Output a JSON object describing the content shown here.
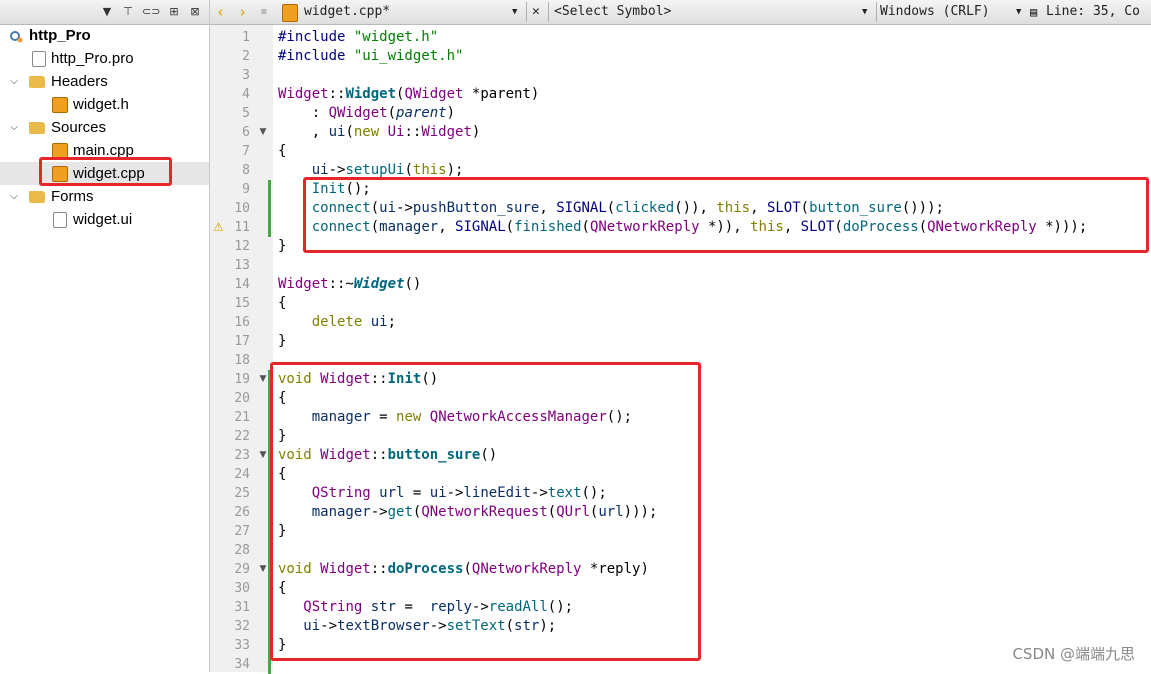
{
  "sidebar": {
    "toolbar_icons": [
      "filter-icon",
      "link-icon",
      "split-icon",
      "close-icon"
    ],
    "tree": [
      {
        "label": "http_Pro",
        "kind": "project",
        "bold": true
      },
      {
        "label": "http_Pro.pro",
        "kind": "pro-file"
      },
      {
        "label": "Headers",
        "kind": "folder"
      },
      {
        "label": "widget.h",
        "kind": "header-file"
      },
      {
        "label": "Sources",
        "kind": "folder"
      },
      {
        "label": "main.cpp",
        "kind": "source-file"
      },
      {
        "label": "widget.cpp",
        "kind": "source-file",
        "selected": true
      },
      {
        "label": "Forms",
        "kind": "folder"
      },
      {
        "label": "widget.ui",
        "kind": "form-file"
      }
    ]
  },
  "editor_toolbar": {
    "file_name": "widget.cpp*",
    "symbol": "<Select Symbol>",
    "line_ending": "Windows (CRLF)",
    "position": "Line: 35, Co"
  },
  "code_lines": [
    [
      [
        "pp",
        "#include "
      ],
      [
        "str",
        "\"widget.h\""
      ]
    ],
    [
      [
        "pp",
        "#include "
      ],
      [
        "str",
        "\"ui_widget.h\""
      ]
    ],
    [],
    [
      [
        "type",
        "Widget"
      ],
      [
        "plain",
        "::"
      ],
      [
        "fnb",
        "Widget"
      ],
      [
        "plain",
        "("
      ],
      [
        "type",
        "QWidget"
      ],
      [
        "plain",
        " *parent)"
      ]
    ],
    [
      [
        "plain",
        "    : "
      ],
      [
        "type",
        "QWidget"
      ],
      [
        "plain",
        "("
      ],
      [
        "param",
        "parent"
      ],
      [
        "plain",
        ")"
      ]
    ],
    [
      [
        "plain",
        "    , "
      ],
      [
        "var",
        "ui"
      ],
      [
        "plain",
        "("
      ],
      [
        "kw",
        "new"
      ],
      [
        "plain",
        " "
      ],
      [
        "type",
        "Ui"
      ],
      [
        "plain",
        "::"
      ],
      [
        "type",
        "Widget"
      ],
      [
        "plain",
        ")"
      ]
    ],
    [
      [
        "plain",
        "{"
      ]
    ],
    [
      [
        "plain",
        "    "
      ],
      [
        "var",
        "ui"
      ],
      [
        "plain",
        "->"
      ],
      [
        "fn",
        "setupUi"
      ],
      [
        "plain",
        "("
      ],
      [
        "kw",
        "this"
      ],
      [
        "plain",
        ");"
      ]
    ],
    [
      [
        "plain",
        "    "
      ],
      [
        "fn",
        "Init"
      ],
      [
        "plain",
        "();"
      ]
    ],
    [
      [
        "plain",
        "    "
      ],
      [
        "fn",
        "connect"
      ],
      [
        "plain",
        "("
      ],
      [
        "var",
        "ui"
      ],
      [
        "plain",
        "->"
      ],
      [
        "var",
        "pushButton_sure"
      ],
      [
        "plain",
        ", "
      ],
      [
        "pp",
        "SIGNAL"
      ],
      [
        "plain",
        "("
      ],
      [
        "fn",
        "clicked"
      ],
      [
        "plain",
        "()), "
      ],
      [
        "kw",
        "this"
      ],
      [
        "plain",
        ", "
      ],
      [
        "pp",
        "SLOT"
      ],
      [
        "plain",
        "("
      ],
      [
        "fn",
        "button_sure"
      ],
      [
        "plain",
        "()));"
      ]
    ],
    [
      [
        "plain",
        "    "
      ],
      [
        "fn",
        "connect"
      ],
      [
        "plain",
        "("
      ],
      [
        "var",
        "manager"
      ],
      [
        "plain",
        ", "
      ],
      [
        "pp",
        "SIGNAL"
      ],
      [
        "plain",
        "("
      ],
      [
        "fn",
        "finished"
      ],
      [
        "plain",
        "("
      ],
      [
        "type",
        "QNetworkReply"
      ],
      [
        "plain",
        " *)), "
      ],
      [
        "kw",
        "this"
      ],
      [
        "plain",
        ", "
      ],
      [
        "pp",
        "SLOT"
      ],
      [
        "plain",
        "("
      ],
      [
        "fn",
        "doProcess"
      ],
      [
        "plain",
        "("
      ],
      [
        "type",
        "QNetworkReply"
      ],
      [
        "plain",
        " *)));"
      ]
    ],
    [
      [
        "plain",
        "}"
      ]
    ],
    [],
    [
      [
        "type",
        "Widget"
      ],
      [
        "plain",
        "::~"
      ],
      [
        "fni",
        "Widget"
      ],
      [
        "plain",
        "()"
      ]
    ],
    [
      [
        "plain",
        "{"
      ]
    ],
    [
      [
        "plain",
        "    "
      ],
      [
        "kw",
        "delete"
      ],
      [
        "plain",
        " "
      ],
      [
        "var",
        "ui"
      ],
      [
        "plain",
        ";"
      ]
    ],
    [
      [
        "plain",
        "}"
      ]
    ],
    [],
    [
      [
        "kw",
        "void"
      ],
      [
        "plain",
        " "
      ],
      [
        "type",
        "Widget"
      ],
      [
        "plain",
        "::"
      ],
      [
        "fnb",
        "Init"
      ],
      [
        "plain",
        "()"
      ]
    ],
    [
      [
        "plain",
        "{"
      ]
    ],
    [
      [
        "plain",
        "    "
      ],
      [
        "var",
        "manager"
      ],
      [
        "plain",
        " = "
      ],
      [
        "kw",
        "new"
      ],
      [
        "plain",
        " "
      ],
      [
        "type",
        "QNetworkAccessManager"
      ],
      [
        "plain",
        "();"
      ]
    ],
    [
      [
        "plain",
        "}"
      ]
    ],
    [
      [
        "kw",
        "void"
      ],
      [
        "plain",
        " "
      ],
      [
        "type",
        "Widget"
      ],
      [
        "plain",
        "::"
      ],
      [
        "fnb",
        "button_sure"
      ],
      [
        "plain",
        "()"
      ]
    ],
    [
      [
        "plain",
        "{"
      ]
    ],
    [
      [
        "plain",
        "    "
      ],
      [
        "type",
        "QString"
      ],
      [
        "plain",
        " "
      ],
      [
        "var",
        "url"
      ],
      [
        "plain",
        " = "
      ],
      [
        "var",
        "ui"
      ],
      [
        "plain",
        "->"
      ],
      [
        "var",
        "lineEdit"
      ],
      [
        "plain",
        "->"
      ],
      [
        "fn",
        "text"
      ],
      [
        "plain",
        "();"
      ]
    ],
    [
      [
        "plain",
        "    "
      ],
      [
        "var",
        "manager"
      ],
      [
        "plain",
        "->"
      ],
      [
        "fn",
        "get"
      ],
      [
        "plain",
        "("
      ],
      [
        "type",
        "QNetworkRequest"
      ],
      [
        "plain",
        "("
      ],
      [
        "type",
        "QUrl"
      ],
      [
        "plain",
        "("
      ],
      [
        "var",
        "url"
      ],
      [
        "plain",
        ")));"
      ]
    ],
    [
      [
        "plain",
        "}"
      ]
    ],
    [],
    [
      [
        "kw",
        "void"
      ],
      [
        "plain",
        " "
      ],
      [
        "type",
        "Widget"
      ],
      [
        "plain",
        "::"
      ],
      [
        "fnb",
        "doProcess"
      ],
      [
        "plain",
        "("
      ],
      [
        "type",
        "QNetworkReply"
      ],
      [
        "plain",
        " *reply)"
      ]
    ],
    [
      [
        "plain",
        "{"
      ]
    ],
    [
      [
        "plain",
        "   "
      ],
      [
        "type",
        "QString"
      ],
      [
        "plain",
        " "
      ],
      [
        "var",
        "str"
      ],
      [
        "plain",
        " =  "
      ],
      [
        "var",
        "reply"
      ],
      [
        "plain",
        "->"
      ],
      [
        "fn",
        "readAll"
      ],
      [
        "plain",
        "();"
      ]
    ],
    [
      [
        "plain",
        "   "
      ],
      [
        "var",
        "ui"
      ],
      [
        "plain",
        "->"
      ],
      [
        "var",
        "textBrowser"
      ],
      [
        "plain",
        "->"
      ],
      [
        "fn",
        "setText"
      ],
      [
        "plain",
        "("
      ],
      [
        "var",
        "str"
      ],
      [
        "plain",
        ");"
      ]
    ],
    [
      [
        "plain",
        "}"
      ]
    ],
    []
  ],
  "line_numbers": [
    "1",
    "2",
    "3",
    "4",
    "5",
    "6",
    "7",
    "8",
    "9",
    "10",
    "11",
    "12",
    "13",
    "14",
    "15",
    "16",
    "17",
    "18",
    "19",
    "20",
    "21",
    "22",
    "23",
    "24",
    "25",
    "26",
    "27",
    "28",
    "29",
    "30",
    "31",
    "32",
    "33",
    "34"
  ],
  "watermark": "CSDN @端端九思",
  "colors": {
    "highlight_box": "#e8262a",
    "change_bar": "#48a848"
  }
}
